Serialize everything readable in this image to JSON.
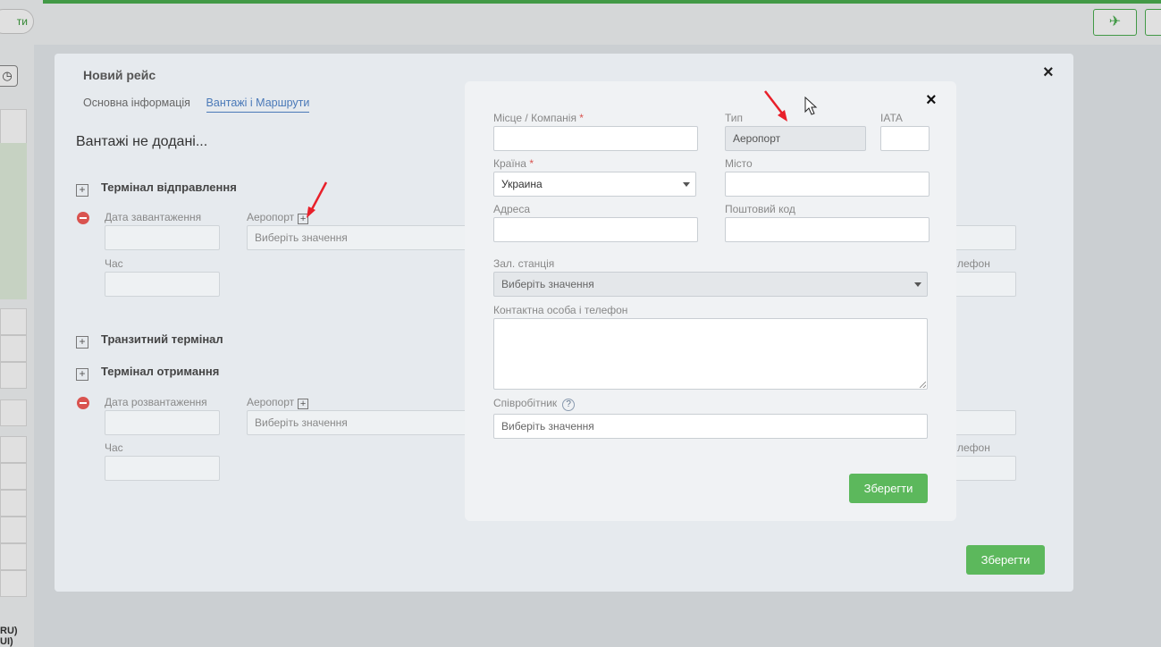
{
  "background": {
    "left_tab_label": "ти",
    "left_bottom_text": [
      "RU)",
      "UI)"
    ]
  },
  "main_modal": {
    "title": "Новий рейс",
    "tabs": [
      {
        "label": "Основна інформація",
        "active": false
      },
      {
        "label": "Вантажі і Маршрути",
        "active": true
      }
    ],
    "empty_cargo": "Вантажі не додані...",
    "sections": {
      "departure": "Термінал відправлення",
      "transit": "Транзитний термінал",
      "arrival": "Термінал отримання"
    },
    "departure_fields": {
      "load_date_label": "Дата завантаження",
      "airport_label": "Аеропорт",
      "airport_placeholder": "Виберіть значення",
      "time_label": "Час",
      "phone_label_fragment": "лефон"
    },
    "arrival_fields": {
      "unload_date_label": "Дата розвантаження",
      "airport_label": "Аеропорт",
      "airport_placeholder": "Виберіть значення",
      "time_label": "Час",
      "phone_label_fragment": "лефон"
    },
    "save_label": "Зберегти"
  },
  "front_modal": {
    "fields": {
      "place_company_label": "Місце / Компанія",
      "type_label": "Тип",
      "type_value": "Аеропорт",
      "iata_label": "IATA",
      "country_label": "Країна",
      "country_value": "Украина",
      "city_label": "Місто",
      "address_label": "Адреса",
      "postal_label": "Поштовий код",
      "railway_label": "Зал. станція",
      "railway_placeholder": "Виберіть значення",
      "contact_label": "Контактна особа і телефон",
      "employee_label": "Співробітник",
      "employee_placeholder": "Виберіть значення"
    },
    "required_mark": "*",
    "help_mark": "?",
    "save_label": "Зберегти"
  },
  "icons": {
    "close": "×",
    "plus": "+",
    "plane": "✈",
    "clock": "◷"
  },
  "colors": {
    "accent_green": "#5cb85c",
    "tab_active": "#4a79b8",
    "required": "#d9534f",
    "annotation_arrow": "#e8202a"
  }
}
